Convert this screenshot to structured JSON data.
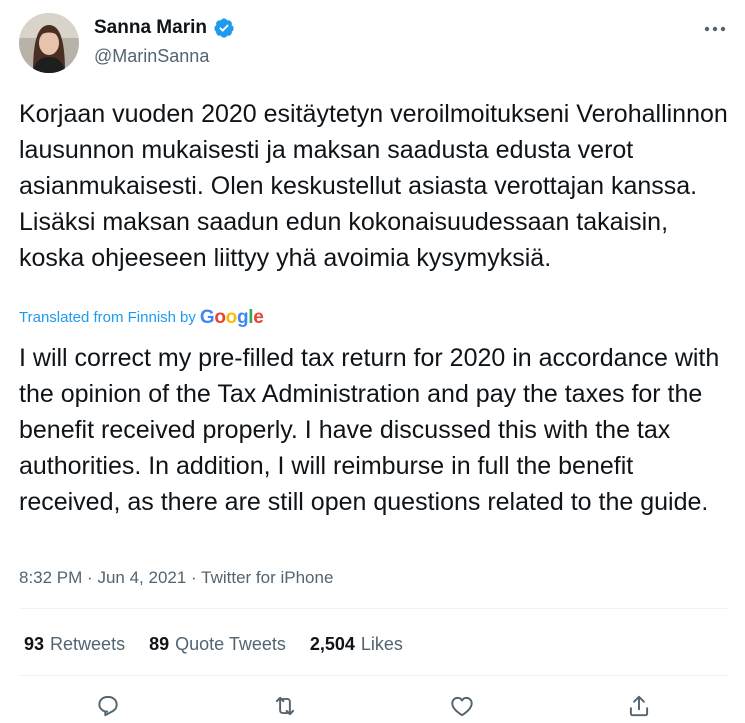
{
  "author": {
    "name": "Sanna Marin",
    "handle": "@MarinSanna",
    "avatar_icon": "avatar-photo",
    "verified": true
  },
  "tweet": {
    "text": "Korjaan vuoden 2020 esitäytetyn veroilmoitukseni Verohallinnon lausunnon mukaisesti ja maksan saadusta edusta verot asianmukaisesti. Olen keskustellut asiasta verottajan kanssa. Lisäksi maksan saadun edun kokonaisuudessaan takaisin, koska ohjeeseen liittyy yhä avoimia kysymyksiä.",
    "translated_label": "Translated from Finnish",
    "translated_by": "by",
    "translator": "Google",
    "translation": "I will correct my pre-filled tax return for 2020 in accordance with the opinion of the Tax Administration and pay the taxes for the benefit received properly. I have discussed this with the tax authorities. In addition, I will reimburse in full the benefit received, as there are still open questions related to the guide.",
    "time": "8:32 PM",
    "date": "Jun 4, 2021",
    "source": "Twitter for iPhone",
    "separator": "·"
  },
  "stats": {
    "retweets": {
      "count": "93",
      "label": "Retweets"
    },
    "quote_tweets": {
      "count": "89",
      "label": "Quote Tweets"
    },
    "likes": {
      "count": "2,504",
      "label": "Likes"
    }
  },
  "colors": {
    "text": "#0f1419",
    "secondary": "#536471",
    "link": "#1d9bf0",
    "divider": "#eff3f4",
    "verified": "#1d9bf0"
  },
  "icons": {
    "more": "more-icon",
    "reply": "reply-icon",
    "retweet": "retweet-icon",
    "like": "heart-icon",
    "share": "share-icon"
  }
}
